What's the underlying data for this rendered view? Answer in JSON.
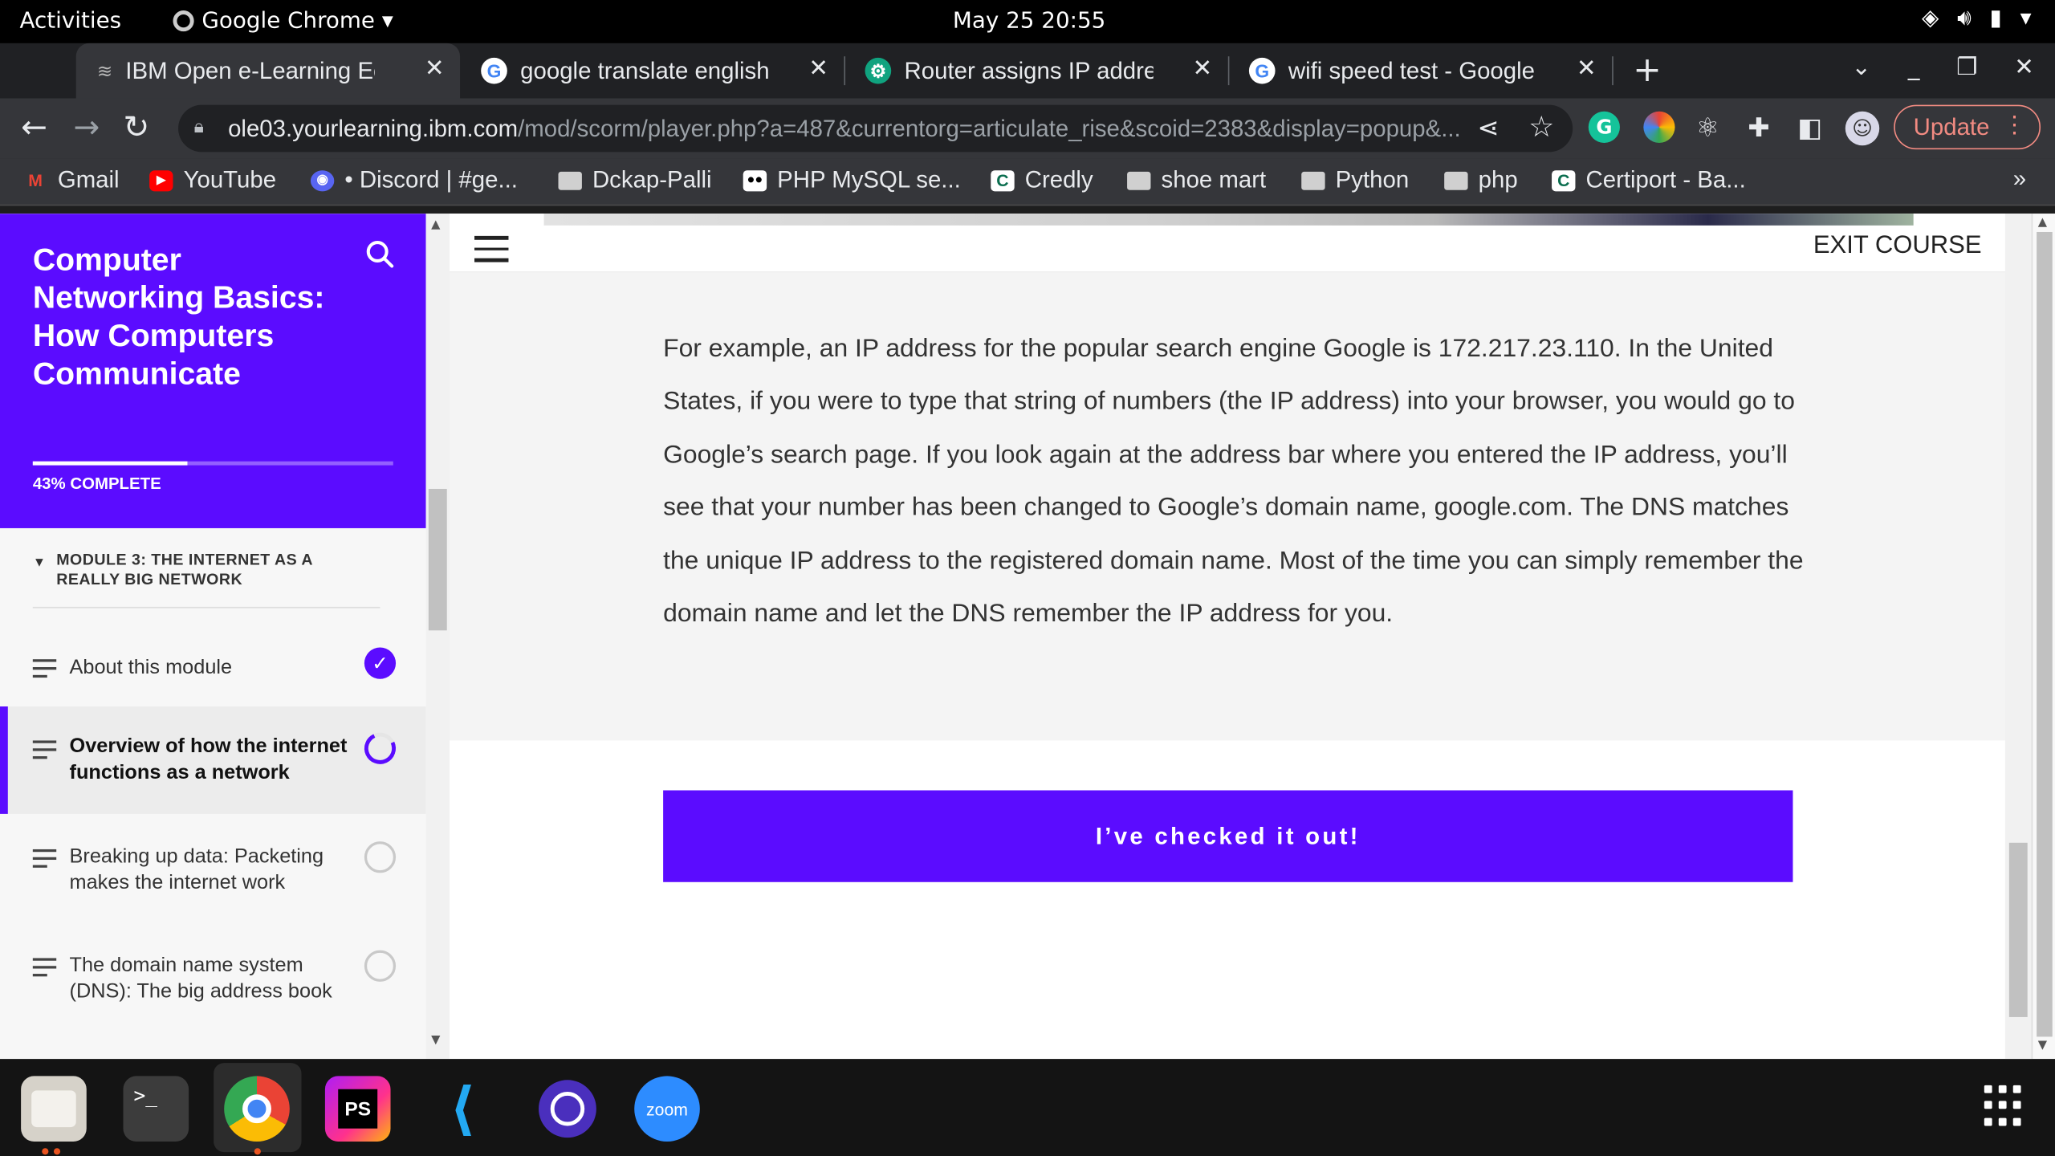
{
  "topbar": {
    "activities": "Activities",
    "app_name": "Google Chrome ▾",
    "clock": "May 25  20:55"
  },
  "tabs": [
    {
      "title": "IBM Open e-Learning Ecosystem",
      "active": true
    },
    {
      "title": "google translate english to",
      "active": false
    },
    {
      "title": "Router assigns IP address",
      "active": false
    },
    {
      "title": "wifi speed test - Google Search",
      "active": false
    }
  ],
  "omnibox": {
    "host": "ole03.yourlearning.ibm.com",
    "path": "/mod/scorm/player.php?a=487&currentorg=articulate_rise&scoid=2383&display=popup&..."
  },
  "update_label": "Update",
  "bookmarks": [
    {
      "label": "Gmail",
      "icon": "gmail-icon"
    },
    {
      "label": "YouTube",
      "icon": "youtube-icon"
    },
    {
      "label": "• Discord | #ge...",
      "icon": "discord-icon"
    },
    {
      "label": "Dckap-Palli",
      "icon": "folder-icon"
    },
    {
      "label": "PHP MySQL se...",
      "icon": "medium-icon"
    },
    {
      "label": "Credly",
      "icon": "credly-icon"
    },
    {
      "label": "shoe mart",
      "icon": "folder-icon"
    },
    {
      "label": "Python",
      "icon": "folder-icon"
    },
    {
      "label": "php",
      "icon": "folder-icon"
    },
    {
      "label": "Certiport - Ba...",
      "icon": "credly-icon"
    }
  ],
  "course": {
    "title": "Computer Networking Basics: How Computers Communicate",
    "progress_label": "43% COMPLETE",
    "progress": 0.43,
    "module": "MODULE 3: THE INTERNET AS A REALLY BIG NETWORK",
    "lessons": [
      {
        "label": "About this module",
        "status": "done"
      },
      {
        "label": "Overview of how the internet functions as a network",
        "status": "partial"
      },
      {
        "label": "Breaking up data: Packeting makes the internet work",
        "status": "empty"
      },
      {
        "label": "The domain name system (DNS): The big address book",
        "status": "empty"
      }
    ]
  },
  "main": {
    "exit_label": "EXIT COURSE",
    "paragraph": "For example, an IP address for the popular search engine Google is 172.217.23.110. In the United States, if you were to type that string of numbers (the IP address) into your browser, you would go to Google’s search page. If you look again at the address bar where you entered the IP address, you’ll see that your number has been changed to Google’s domain name, google.com. The DNS matches the unique IP address to the registered domain name. Most of the time you can simply remember the domain name and let the DNS remember the IP address for you.",
    "cta_label": "I’ve checked it out!"
  },
  "colors": {
    "brand": "#5b0cff"
  }
}
